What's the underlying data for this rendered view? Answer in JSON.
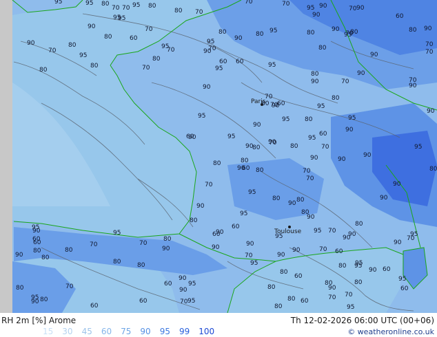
{
  "map": {
    "cities": [
      "Paris",
      "Toulouse"
    ],
    "colors": {
      "land_low": "#d6d6d6",
      "sea": "#97c7eb",
      "rh_90": "#7eb2e8",
      "rh_95": "#5b93e6",
      "rh_99": "#3468e0",
      "coastline": "#1aa61a",
      "contour": "#5a6470"
    },
    "contour_values": [
      "80",
      "95",
      "80",
      "95",
      "95",
      "95",
      "90",
      "95",
      "90",
      "80",
      "95",
      "95",
      "90",
      "90",
      "90",
      "90",
      "80",
      "95",
      "90",
      "90",
      "95",
      "90",
      "80",
      "95",
      "95",
      "90",
      "95",
      "95",
      "95",
      "95",
      "90",
      "90",
      "95",
      "80",
      "90",
      "80",
      "95",
      "95",
      "90",
      "90",
      "90",
      "90",
      "80",
      "90",
      "90",
      "90",
      "95",
      "80",
      "80",
      "90",
      "90",
      "90",
      "90",
      "70",
      "90",
      "80",
      "90",
      "95",
      "70",
      "70",
      "90",
      "90",
      "90",
      "80",
      "90",
      "95",
      "70",
      "80",
      "90",
      "80",
      "90",
      "80",
      "90",
      "95",
      "80",
      "90",
      "90",
      "90",
      "80",
      "80",
      "80",
      "80",
      "90",
      "70",
      "90",
      "95",
      "95",
      "95",
      "95",
      "80",
      "95",
      "80",
      "70",
      "90",
      "80",
      "90",
      "80",
      "90",
      "70",
      "80",
      "80",
      "95",
      "70",
      "90",
      "70",
      "70",
      "60",
      "70",
      "60",
      "70",
      "70",
      "60",
      "60",
      "80",
      "70",
      "80",
      "60",
      "60",
      "70",
      "80",
      "60",
      "90",
      "90",
      "70",
      "60",
      "80",
      "70",
      "70",
      "80",
      "60",
      "80",
      "70",
      "95",
      "95",
      "70",
      "95",
      "60",
      "70",
      "70",
      "60",
      "80",
      "80",
      "60",
      "60",
      "70",
      "60",
      "60",
      "70",
      "70",
      "70",
      "80",
      "80",
      "60",
      "60",
      "95",
      "95",
      "90",
      "90",
      "80",
      "70",
      "80",
      "70",
      "95",
      "70",
      "70",
      "80",
      "80",
      "60",
      "70",
      "70",
      "80",
      "60",
      "70",
      "80",
      "80",
      "95",
      "80",
      "60"
    ]
  },
  "footer": {
    "title": "RH 2m [%] Arome",
    "valid": "Th 12-02-2026 06:00 UTC (00+06)",
    "credit": "© weatheronline.co.uk",
    "legend": [
      {
        "label": "15",
        "color": "#c9e0f5"
      },
      {
        "label": "30",
        "color": "#b4d2ef"
      },
      {
        "label": "45",
        "color": "#9ec4ea"
      },
      {
        "label": "60",
        "color": "#86b6ea"
      },
      {
        "label": "75",
        "color": "#6ea6e6"
      },
      {
        "label": "90",
        "color": "#5590e4"
      },
      {
        "label": "95",
        "color": "#3c78e0"
      },
      {
        "label": "99",
        "color": "#2860dc"
      },
      {
        "label": "100",
        "color": "#1c48d4"
      }
    ]
  }
}
